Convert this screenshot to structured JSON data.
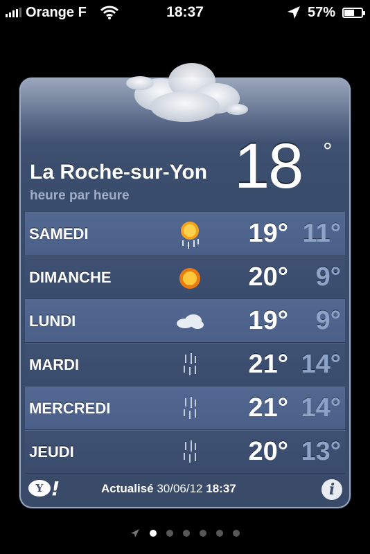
{
  "status": {
    "carrier": "Orange F",
    "time": "18:37",
    "battery": "57%",
    "battery_level": 0.57,
    "icons": [
      "signal-icon",
      "wifi-icon",
      "location-icon",
      "battery-icon"
    ]
  },
  "weather": {
    "city": "La Roche-sur-Yon",
    "subtitle": "heure par heure",
    "current_temp": "18",
    "degree": "°",
    "forecast": [
      {
        "day": "SAMEDI",
        "icon": "sun-rain-icon",
        "high": "19°",
        "low": "11°"
      },
      {
        "day": "DIMANCHE",
        "icon": "sun-icon",
        "high": "20°",
        "low": "9°"
      },
      {
        "day": "LUNDI",
        "icon": "cloud-icon",
        "high": "19°",
        "low": "9°"
      },
      {
        "day": "MARDI",
        "icon": "rain-icon",
        "high": "21°",
        "low": "14°"
      },
      {
        "day": "MERCREDI",
        "icon": "rain-icon",
        "high": "21°",
        "low": "14°"
      },
      {
        "day": "JEUDI",
        "icon": "rain-icon",
        "high": "20°",
        "low": "13°"
      }
    ]
  },
  "footer": {
    "updated_label": "Actualisé",
    "updated_date": "30/06/12",
    "updated_time": "18:37",
    "yahoo_logo": "Y!",
    "info_label": "i"
  },
  "pager": {
    "count": 6,
    "active": 1,
    "first_icon": "location-arrow-icon"
  },
  "colors": {
    "card": "#3a4c6c",
    "low_temp": "#8ea3c8",
    "background": "#000000"
  }
}
